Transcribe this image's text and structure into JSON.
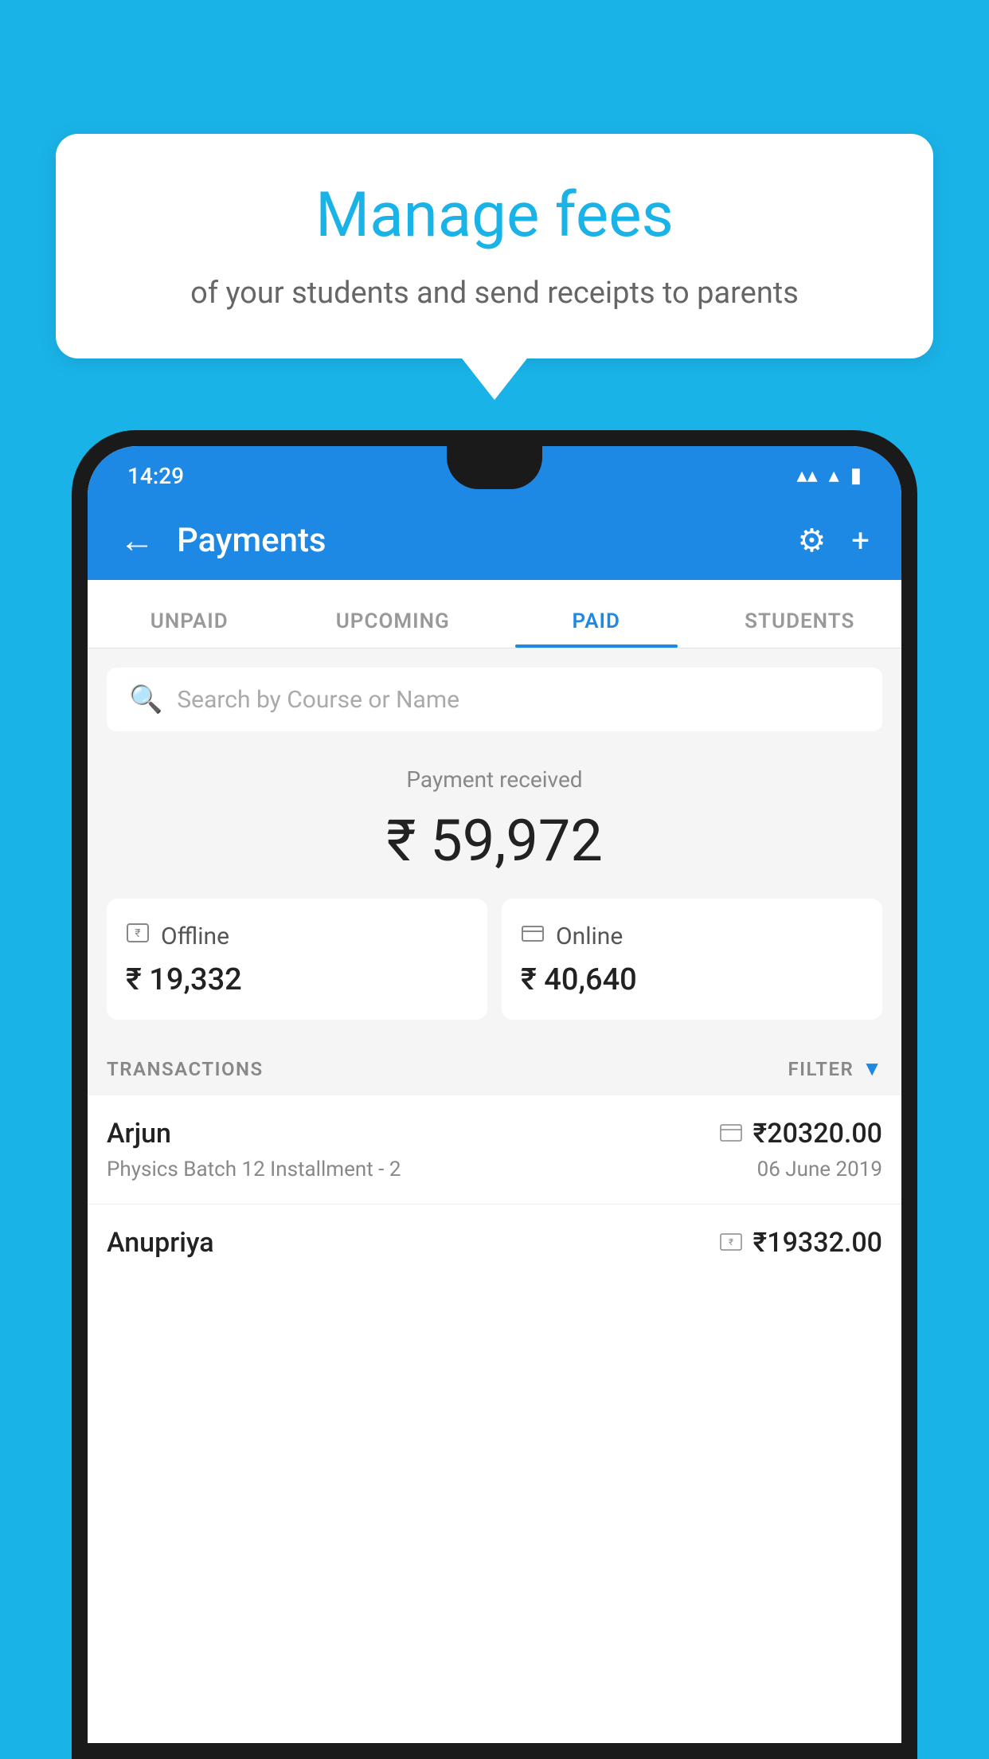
{
  "background_color": "#1ab3e8",
  "speech_bubble": {
    "title": "Manage fees",
    "subtitle": "of your students and send receipts to parents"
  },
  "status_bar": {
    "time": "14:29",
    "wifi_icon": "▲",
    "signal_icon": "▲",
    "battery_icon": "▮"
  },
  "header": {
    "title": "Payments",
    "back_icon": "←",
    "settings_icon": "⚙",
    "add_icon": "+"
  },
  "tabs": [
    {
      "label": "UNPAID",
      "active": false
    },
    {
      "label": "UPCOMING",
      "active": false
    },
    {
      "label": "PAID",
      "active": true
    },
    {
      "label": "STUDENTS",
      "active": false
    }
  ],
  "search": {
    "placeholder": "Search by Course or Name"
  },
  "payment_received": {
    "label": "Payment received",
    "amount": "₹ 59,972"
  },
  "payment_cards": [
    {
      "icon": "💳",
      "label": "Offline",
      "amount": "₹ 19,332"
    },
    {
      "icon": "💳",
      "label": "Online",
      "amount": "₹ 40,640"
    }
  ],
  "transactions_section": {
    "label": "TRANSACTIONS",
    "filter_label": "FILTER"
  },
  "transactions": [
    {
      "name": "Arjun",
      "course": "Physics Batch 12 Installment - 2",
      "amount": "₹20320.00",
      "date": "06 June 2019",
      "payment_type": "online"
    },
    {
      "name": "Anupriya",
      "course": "",
      "amount": "₹19332.00",
      "date": "",
      "payment_type": "offline"
    }
  ]
}
